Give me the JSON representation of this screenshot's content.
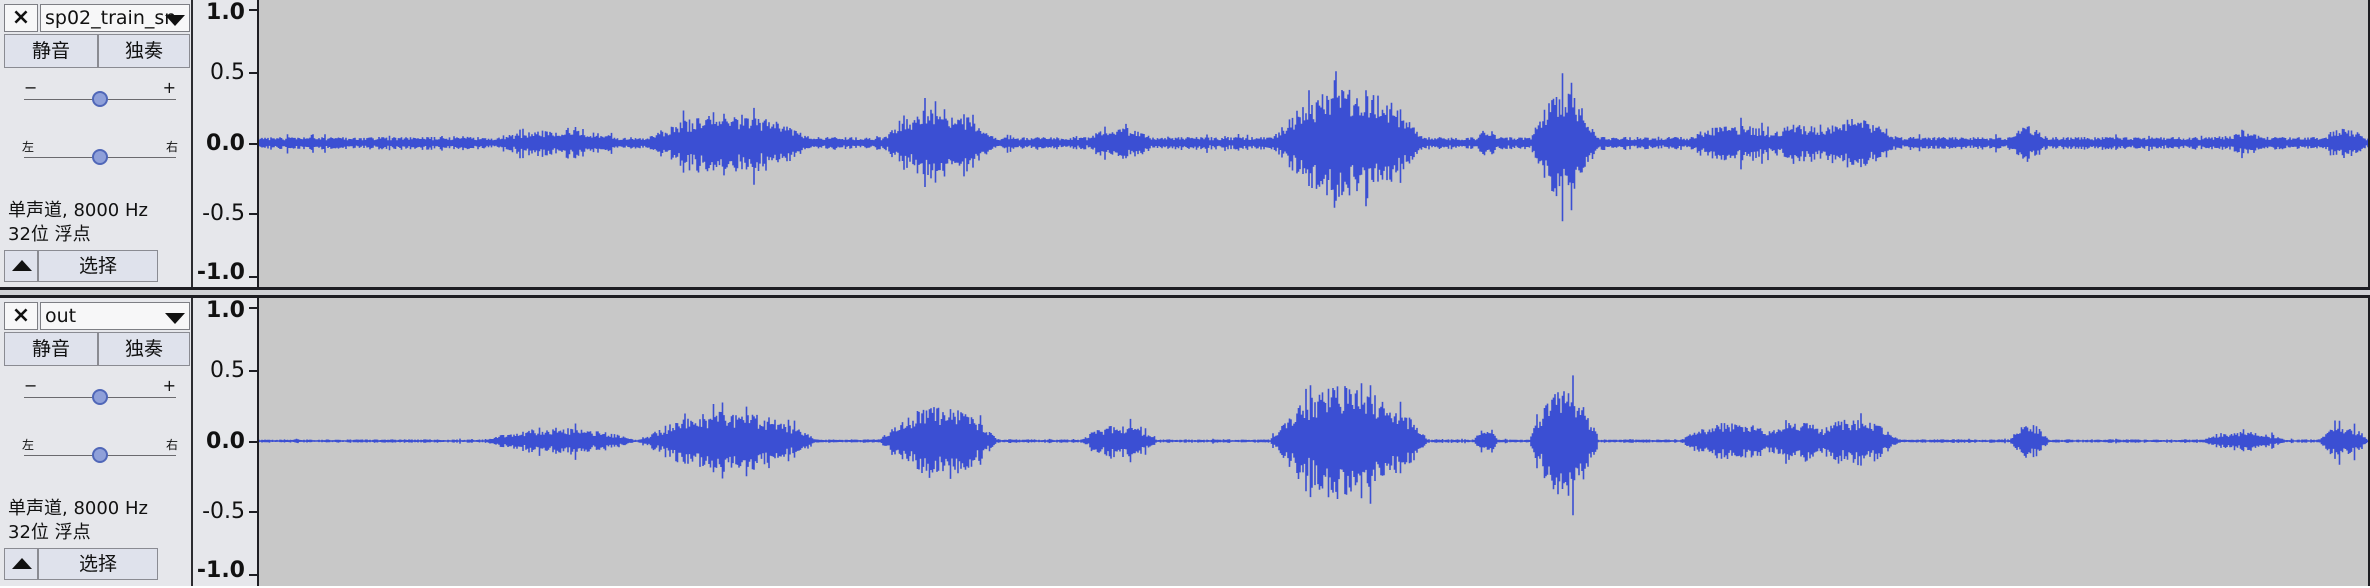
{
  "tracks": [
    {
      "name": "sp02_train_sn",
      "mute_label": "静音",
      "solo_label": "独奏",
      "gain_minus": "−",
      "gain_plus": "+",
      "pan_left": "左",
      "pan_right": "右",
      "gain_level": 0.5,
      "pan_level": 0.5,
      "info_line1": "单声道, 8000 Hz",
      "info_line2": "32位 浮点",
      "select_label": "选择",
      "scale_labels": [
        "1.0",
        "0.5",
        "0.0",
        "-0.5",
        "-1.0"
      ],
      "waveform_color": "#3b4fd3",
      "noisy": true
    },
    {
      "name": "out",
      "mute_label": "静音",
      "solo_label": "独奏",
      "gain_minus": "−",
      "gain_plus": "+",
      "pan_left": "左",
      "pan_right": "右",
      "gain_level": 0.5,
      "pan_level": 0.5,
      "info_line1": "单声道, 8000 Hz",
      "info_line2": "32位 浮点",
      "select_label": "选择",
      "scale_labels": [
        "1.0",
        "0.5",
        "0.0",
        "-0.5",
        "-1.0"
      ],
      "waveform_color": "#3b4fd3",
      "noisy": false
    }
  ],
  "icons": {
    "close": "close-icon",
    "dropdown": "chevron-down-icon",
    "collapse": "chevron-up-icon"
  }
}
